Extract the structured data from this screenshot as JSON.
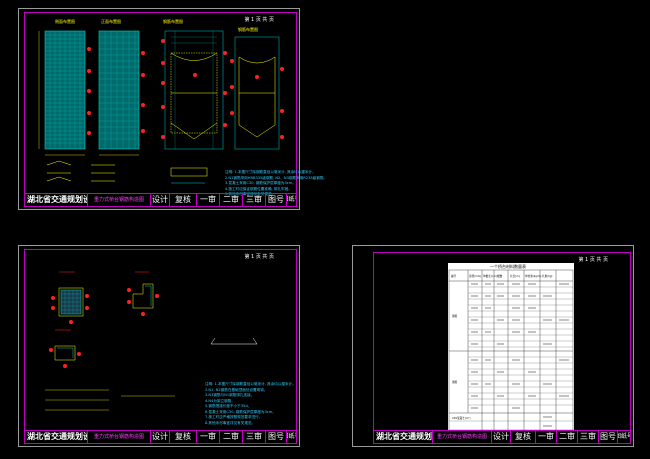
{
  "sheets": [
    {
      "id": "sheet-1",
      "sheet_no": "第 1 页 共 页",
      "views": [
        "侧面布置图",
        "正面布置图",
        "钢筋布置图",
        "钢筋布置图"
      ],
      "notes": [
        "注明: 1.本图尺寸除钢筋直径以毫米计, 其余均以厘米计。",
        "2.N1钢筋采用HRB335级钢筋, N2、N3钢筋采用R235级钢筋。",
        "3.混凝土采用C30, 钢筋保护层厚度为3cm。",
        "4.施工时应保证钢筋位置准确, 绑扎牢固。",
        "5.其他未尽事宜详见有关规范。"
      ],
      "title_block": [
        "湖北省交通规划设计院",
        "重力式桥台钢筋构造图",
        "设计",
        "复核",
        "一审",
        "二审",
        "三审",
        "图号",
        "图纸号"
      ]
    },
    {
      "id": "sheet-2",
      "sheet_no": "第 1 页 共 页",
      "notes": [
        "注明: 1.本图尺寸除钢筋直径以毫米计, 其余均以厘米计。",
        "2.N1, N2钢筋在基础顶面处设置弯钩。",
        "3.N3钢筋与N1钢筋绑扎连接。",
        "4.N4为架立钢筋。",
        "5.钢筋搭接长度不小于35d。",
        "6.混凝土采用C30, 钢筋保护层厚度为3cm。",
        "7.施工时应严格按照规范要求进行。",
        "8.其他未尽事宜详见有关规范。"
      ],
      "title_block": [
        "湖北省交通规划设计院",
        "重力式桥台钢筋构造图",
        "设计",
        "复核",
        "一审",
        "二审",
        "三审",
        "图号",
        "图纸号"
      ]
    },
    {
      "id": "sheet-3",
      "sheet_no": "第 1 页 共 页",
      "table_title": "一个桥台材料数量表",
      "table_header": [
        "编号",
        "直径(mm)",
        "单根长(cm)",
        "根数",
        "共长(m)",
        "单位重(kg/m)",
        "共重(kg)"
      ],
      "table_side_labels": [
        "钢筋",
        "钢筋"
      ],
      "table_footer_label": "C30混凝土(m³)",
      "title_block": [
        "湖北省交通规划设计院",
        "重力式桥台钢筋构造图",
        "设计",
        "复核",
        "一审",
        "二审",
        "三审",
        "图号",
        "图纸号"
      ]
    }
  ],
  "colors": {
    "background": "#000000",
    "frame": "#c000c0",
    "rebar": "#00c0c0",
    "dimension": "#ffff00",
    "marker": "#ff2020",
    "notes": "#33ccff"
  }
}
